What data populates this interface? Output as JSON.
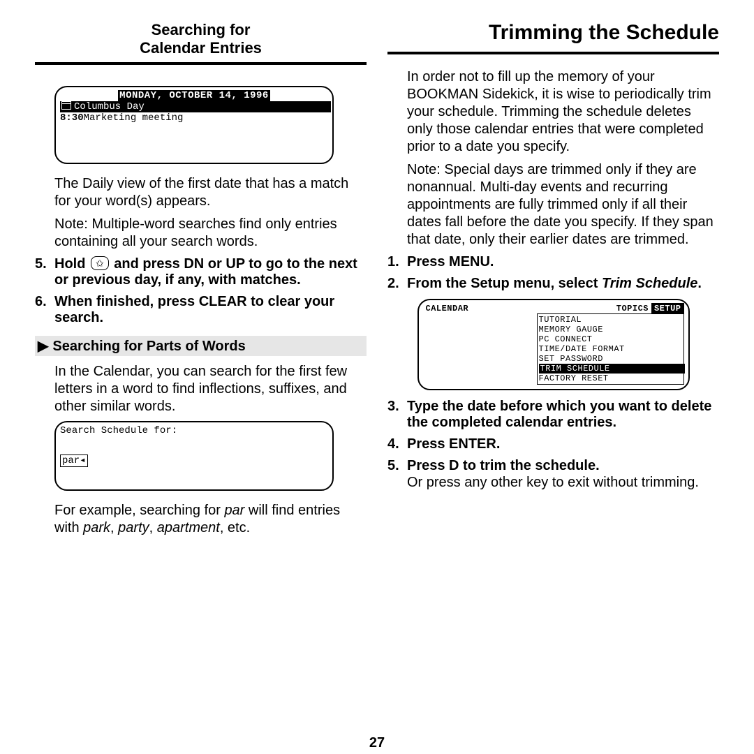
{
  "page_number": "27",
  "left": {
    "header_line1": "Searching for",
    "header_line2": "Calendar Entries",
    "lcd1": {
      "date": "MONDAY, OCTOBER 14, 1996",
      "row1": "Columbus Day",
      "row2_time": "8:30",
      "row2_text": "Marketing meeting"
    },
    "p1": "The Daily view of the first date that has a match for your word(s) appears.",
    "p2": "Note: Multiple-word searches find only entries containing all your search words.",
    "step5_num": "5.",
    "step5_a": "Hold ",
    "step5_star": "✩",
    "step5_b": " and press DN or UP to go to the next or previous day, if any, with matches.",
    "step6_num": "6.",
    "step6": "When finished, press CLEAR to clear your search.",
    "subhead": "Searching for Parts of Words",
    "p3": "In the Calendar, you can search for the first few letters in a word to find inflections, suffixes, and other similar words.",
    "lcd2": {
      "prompt": "Search Schedule for:",
      "value": "par",
      "caret": "◂"
    },
    "p4_a": "For example, searching for ",
    "p4_par": "par",
    "p4_b": " will find entries with ",
    "p4_park": "park",
    "p4_c": ", ",
    "p4_party": "party",
    "p4_d": ", ",
    "p4_apt": "apartment",
    "p4_e": ", etc."
  },
  "right": {
    "header": "Trimming the Schedule",
    "p1": "In order not to fill up the memory of your BOOKMAN Sidekick, it is wise to periodically trim your schedule. Trimming the schedule deletes only those calendar entries that were completed prior to a date you specify.",
    "p2": "Note: Special days are trimmed only if they are nonannual. Multi-day events and recurring appointments are fully trimmed only if all their dates fall before the date you specify. If they span that date, only their earlier dates are trimmed.",
    "step1_num": "1.",
    "step1": "Press MENU.",
    "step2_num": "2.",
    "step2_a": "From the Setup menu, select ",
    "step2_b": "Trim Schedule",
    "step2_c": ".",
    "lcd": {
      "tab1": "CALENDAR",
      "tab2": "TOPICS",
      "tab3": "SETUP",
      "items": [
        "TUTORIAL",
        "MEMORY GAUGE",
        "PC CONNECT",
        "TIME/DATE FORMAT",
        "SET PASSWORD",
        "TRIM SCHEDULE",
        "FACTORY RESET"
      ],
      "selected_index": 5
    },
    "step3_num": "3.",
    "step3": "Type the date before which you want to delete the completed calendar entries.",
    "step4_num": "4.",
    "step4": "Press ENTER.",
    "step5_num": "5.",
    "step5": "Press D to trim the schedule.",
    "p3": "Or press any other key to exit without trimming."
  }
}
